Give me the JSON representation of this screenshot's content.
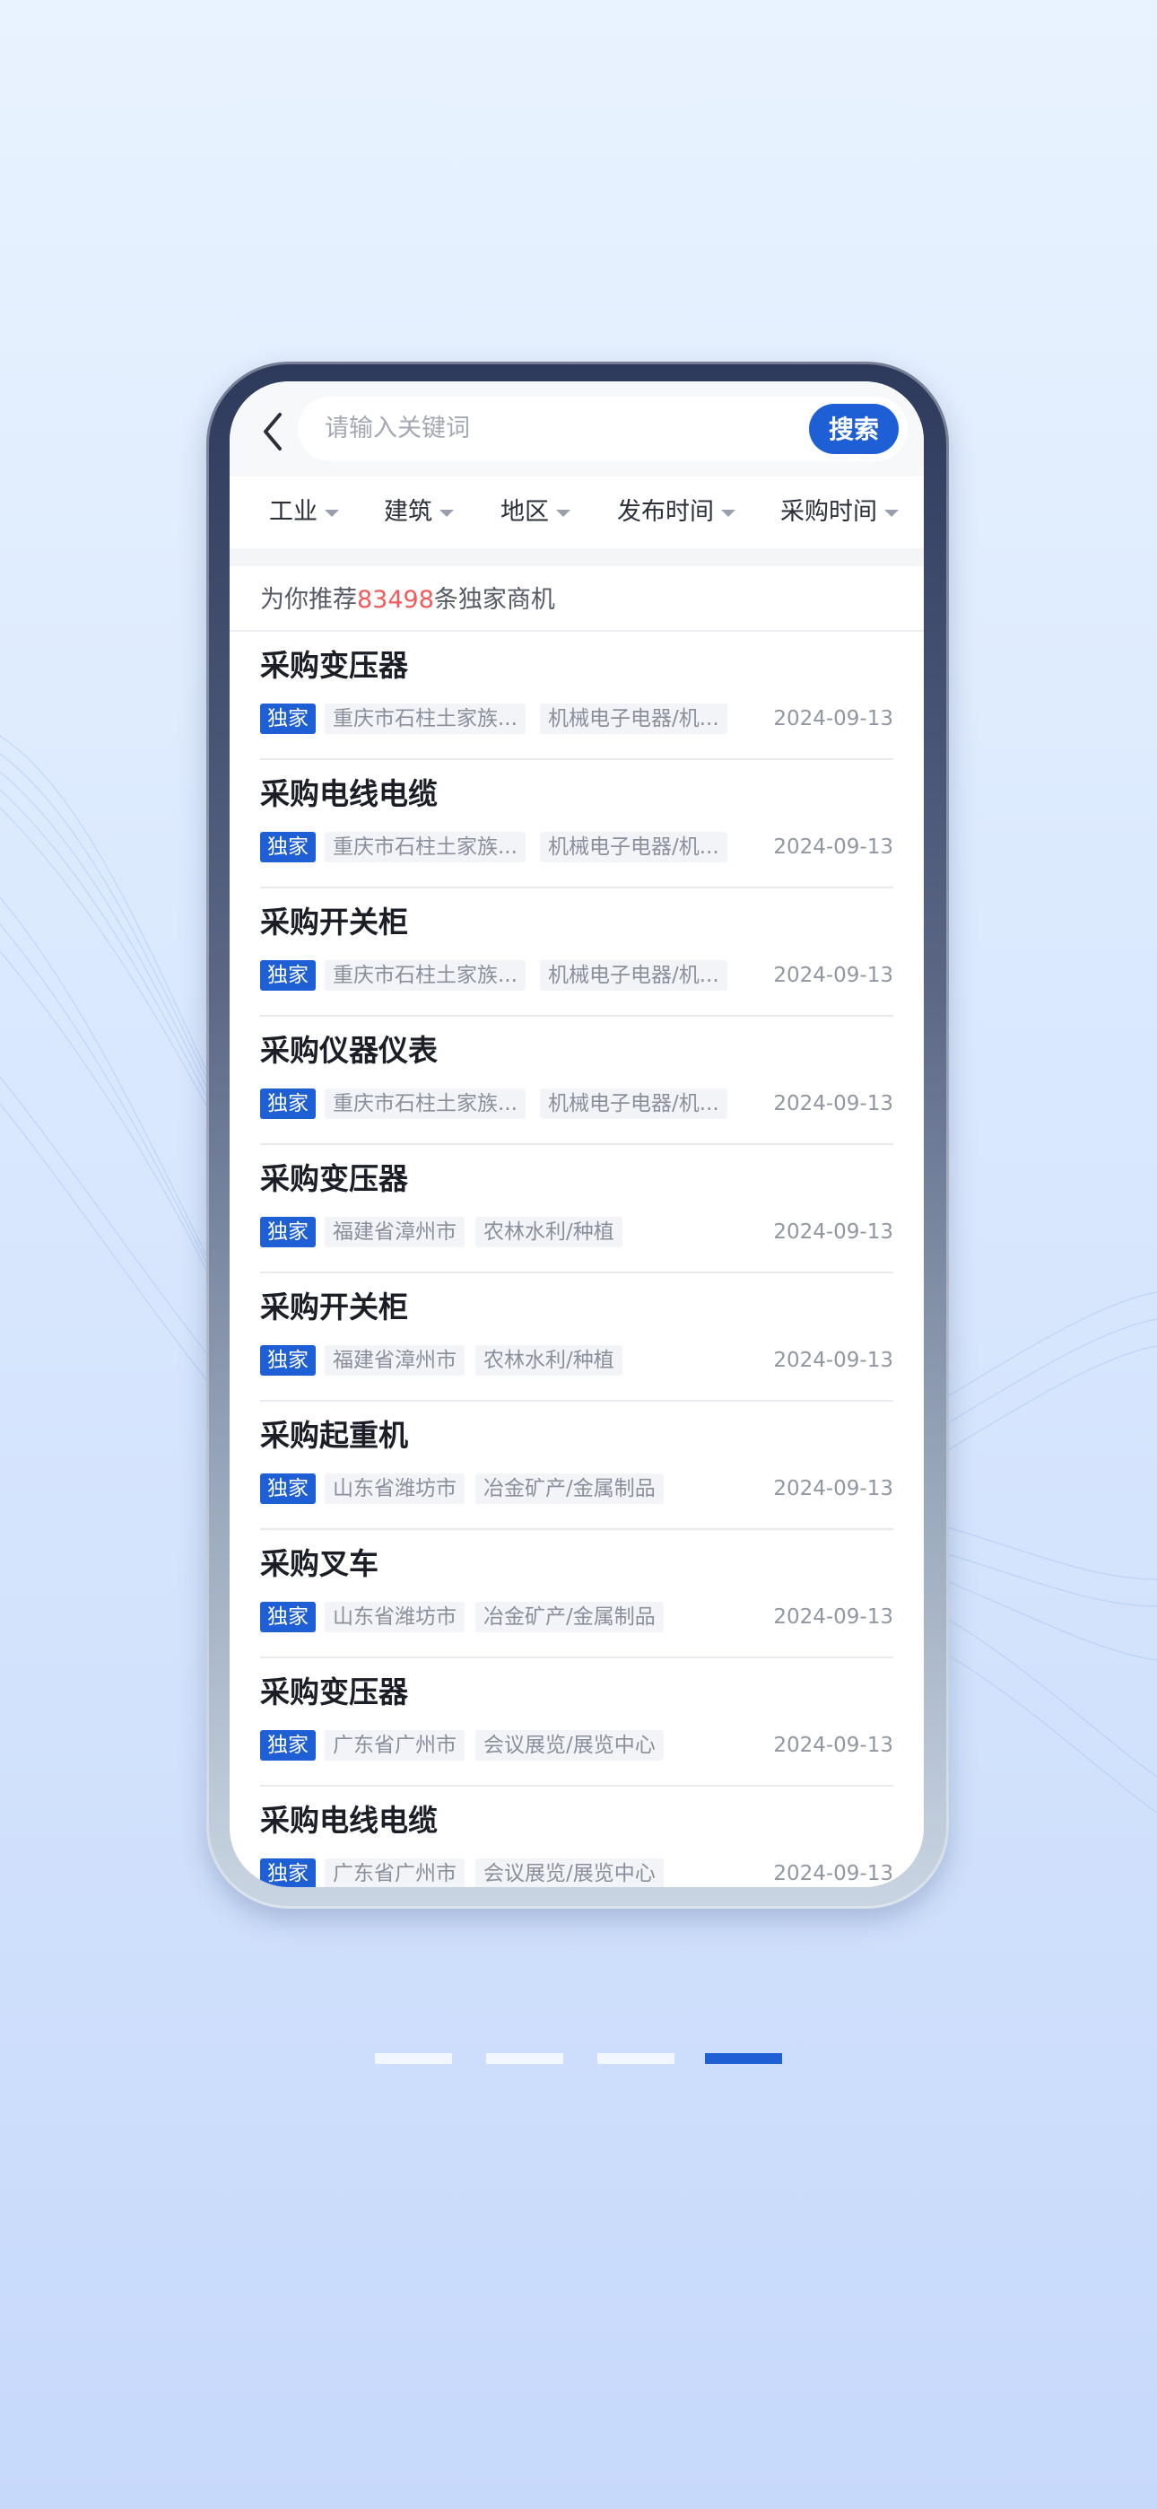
{
  "search": {
    "placeholder": "请输入关键词",
    "button_label": "搜索"
  },
  "filters": [
    {
      "label": "工业"
    },
    {
      "label": "建筑"
    },
    {
      "label": "地区"
    },
    {
      "label": "发布时间"
    },
    {
      "label": "采购时间"
    }
  ],
  "recommendation": {
    "prefix": "为你推荐",
    "count": "83498",
    "suffix": "条独家商机"
  },
  "items": [
    {
      "title": "采购变压器",
      "badge": "独家",
      "region": "重庆市石柱土家族...",
      "industry": "机械电子电器/机...",
      "date": "2024-09-13"
    },
    {
      "title": "采购电线电缆",
      "badge": "独家",
      "region": "重庆市石柱土家族...",
      "industry": "机械电子电器/机...",
      "date": "2024-09-13"
    },
    {
      "title": "采购开关柜",
      "badge": "独家",
      "region": "重庆市石柱土家族...",
      "industry": "机械电子电器/机...",
      "date": "2024-09-13"
    },
    {
      "title": "采购仪器仪表",
      "badge": "独家",
      "region": "重庆市石柱土家族...",
      "industry": "机械电子电器/机...",
      "date": "2024-09-13"
    },
    {
      "title": "采购变压器",
      "badge": "独家",
      "region": "福建省漳州市",
      "industry": "农林水利/种植",
      "date": "2024-09-13"
    },
    {
      "title": "采购开关柜",
      "badge": "独家",
      "region": "福建省漳州市",
      "industry": "农林水利/种植",
      "date": "2024-09-13"
    },
    {
      "title": "采购起重机",
      "badge": "独家",
      "region": "山东省潍坊市",
      "industry": "冶金矿产/金属制品",
      "date": "2024-09-13"
    },
    {
      "title": "采购叉车",
      "badge": "独家",
      "region": "山东省潍坊市",
      "industry": "冶金矿产/金属制品",
      "date": "2024-09-13"
    },
    {
      "title": "采购变压器",
      "badge": "独家",
      "region": "广东省广州市",
      "industry": "会议展览/展览中心",
      "date": "2024-09-13"
    },
    {
      "title": "采购电线电缆",
      "badge": "独家",
      "region": "广东省广州市",
      "industry": "会议展览/展览中心",
      "date": "2024-09-13"
    }
  ],
  "pagination": {
    "total": 4,
    "active_index": 3
  },
  "colors": {
    "accent": "#1f5fd6",
    "highlight": "#f25a5a",
    "background": "#dceafe"
  }
}
